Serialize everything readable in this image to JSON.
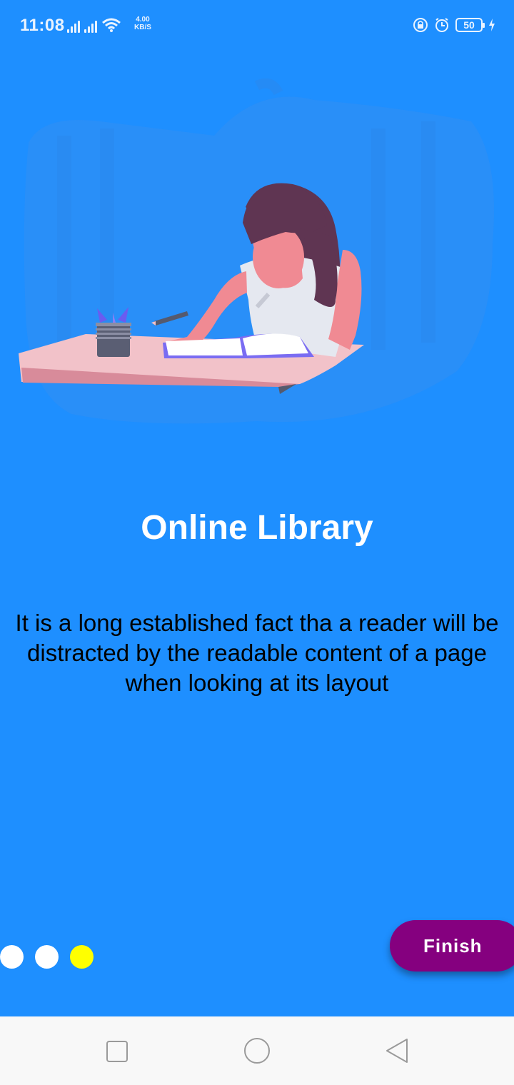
{
  "status_bar": {
    "time": "11:08",
    "net_speed_value": "4.00",
    "net_speed_unit": "KB/S",
    "battery_level": "50",
    "icons": [
      "signal-icon",
      "signal-icon",
      "wifi-icon",
      "lock-rotation-icon",
      "alarm-icon",
      "battery-icon",
      "charging-icon"
    ]
  },
  "onboarding": {
    "title": "Online Library",
    "description": "It is a long established fact tha a reader will be distracted by the readable content of a page when looking at its layout",
    "page_indicator": {
      "count": 3,
      "active_index": 2
    },
    "finish_label": "Finish"
  },
  "navigation_bar": {
    "icons": [
      "recent-apps-icon",
      "home-icon",
      "back-icon"
    ]
  },
  "colors": {
    "background": "#1e8fff",
    "title": "#ffffff",
    "description": "#000000",
    "dot_inactive": "#ffffff",
    "dot_active": "#ffff00",
    "finish_button": "#85007f",
    "nav_bar": "#f8f8f8"
  }
}
